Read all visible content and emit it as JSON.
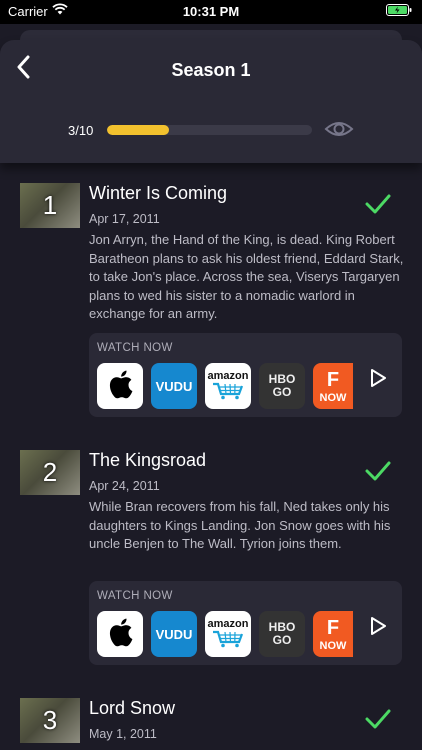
{
  "status_bar": {
    "carrier": "Carrier",
    "time": "10:31 PM"
  },
  "header": {
    "title": "Season 1",
    "progress_text": "3/10",
    "progress_fraction": 0.3
  },
  "colors": {
    "accent": "#f2c12e",
    "check": "#4cd964",
    "background": "#1c1b26",
    "card": "#2a2936"
  },
  "watch_now_label": "WATCH NOW",
  "providers": [
    {
      "name": "apple-tv",
      "label": ""
    },
    {
      "name": "vudu",
      "label": "VUDU"
    },
    {
      "name": "amazon",
      "label": "amazon"
    },
    {
      "name": "hbo-go",
      "label_top": "HBO",
      "label_bottom": "GO"
    },
    {
      "name": "fandango-now",
      "label_top": "F",
      "label_bottom": "NOW"
    }
  ],
  "episodes": [
    {
      "number": "1",
      "title": "Winter Is Coming",
      "date": "Apr 17, 2011",
      "description": "Jon Arryn, the Hand of the King, is dead. King Robert Baratheon plans to ask his oldest friend, Eddard Stark, to take Jon's place. Across the sea, Viserys Targaryen plans to wed his sister to a nomadic warlord in exchange for an army.",
      "watched": true
    },
    {
      "number": "2",
      "title": "The Kingsroad",
      "date": "Apr 24, 2011",
      "description": "While Bran recovers from his fall, Ned takes only his daughters to Kings Landing. Jon Snow goes with his uncle Benjen to The Wall. Tyrion joins them.",
      "watched": true
    },
    {
      "number": "3",
      "title": "Lord Snow",
      "date": "May 1, 2011",
      "description": "",
      "watched": true
    }
  ]
}
